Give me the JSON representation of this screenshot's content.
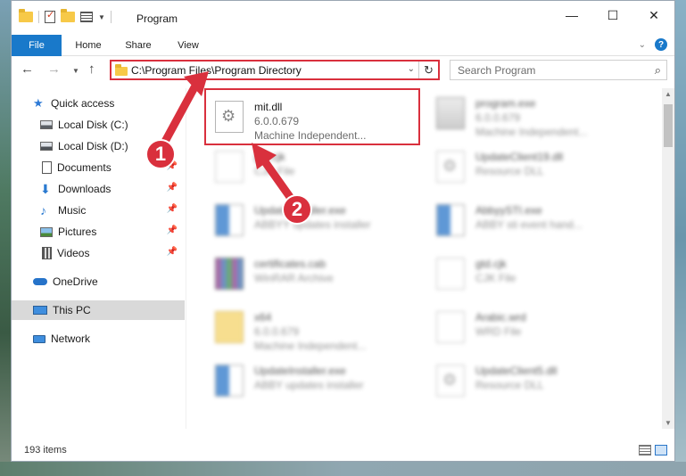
{
  "window": {
    "title": "Program",
    "controls": {
      "minimize": "—",
      "maximize": "☐",
      "close": "✕"
    }
  },
  "ribbon": {
    "tabs": [
      "File",
      "Home",
      "Share",
      "View"
    ],
    "help": "?"
  },
  "nav": {
    "address": "C:\\Program Files\\Program Directory",
    "search_placeholder": "Search Program"
  },
  "sidebar": {
    "items": [
      {
        "label": "Quick access",
        "icon": "star-icon",
        "pinned": false
      },
      {
        "label": "Local Disk (C:)",
        "icon": "disk-icon",
        "pinned": false
      },
      {
        "label": "Local Disk (D:)",
        "icon": "disk-icon",
        "pinned": false
      },
      {
        "label": "Documents",
        "icon": "documents-icon",
        "pinned": true
      },
      {
        "label": "Downloads",
        "icon": "downloads-icon",
        "pinned": true
      },
      {
        "label": "Music",
        "icon": "music-icon",
        "pinned": true
      },
      {
        "label": "Pictures",
        "icon": "pictures-icon",
        "pinned": true
      },
      {
        "label": "Videos",
        "icon": "videos-icon",
        "pinned": true
      },
      {
        "label": "OneDrive",
        "icon": "onedrive-icon",
        "pinned": false
      },
      {
        "label": "This PC",
        "icon": "this-pc-icon",
        "pinned": false,
        "selected": true
      },
      {
        "label": "Network",
        "icon": "network-icon",
        "pinned": false
      }
    ]
  },
  "files": [
    {
      "name": "mit.dll",
      "line1": "6.0.0.679",
      "line2": "Machine Independent...",
      "icon": "dll-icon",
      "highlighted": true
    },
    {
      "name": "program.exe",
      "line1": "6.0.0.679",
      "line2": "Machine Independent...",
      "icon": "exe-icon"
    },
    {
      "name": "gtd.cjk",
      "line1": "CJK File",
      "line2": "",
      "icon": "file-icon"
    },
    {
      "name": "UpdateClient19.dll",
      "line1": "Resource DLL",
      "line2": "",
      "icon": "dll-icon"
    },
    {
      "name": "UpdateInstaller.exe",
      "line1": "ABBYY updates installer",
      "line2": "",
      "icon": "installer-icon"
    },
    {
      "name": "AbbyySTI.exe",
      "line1": "ABBY sti event hand...",
      "line2": "",
      "icon": "installer-icon"
    },
    {
      "name": "certificates.cab",
      "line1": "WinRAR Archive",
      "line2": "",
      "icon": "archive-icon"
    },
    {
      "name": "gtd.cjk",
      "line1": "CJK File",
      "line2": "",
      "icon": "file-icon"
    },
    {
      "name": "x64",
      "line1": "6.0.0.679",
      "line2": "Machine Independent...",
      "icon": "folder-zip-icon"
    },
    {
      "name": "Arabic.wrd",
      "line1": "WRD File",
      "line2": "",
      "icon": "file-icon"
    },
    {
      "name": "UpdateInstaller.exe",
      "line1": "ABBY updates installer",
      "line2": "",
      "icon": "installer-icon"
    },
    {
      "name": "UpdateClient5.dll",
      "line1": "Resource DLL",
      "line2": "",
      "icon": "dll-icon"
    }
  ],
  "annotations": {
    "step1": "1",
    "step2": "2"
  },
  "status": {
    "item_count": "193 items"
  },
  "colors": {
    "accent": "#1979ca",
    "highlight": "#d9303d"
  }
}
